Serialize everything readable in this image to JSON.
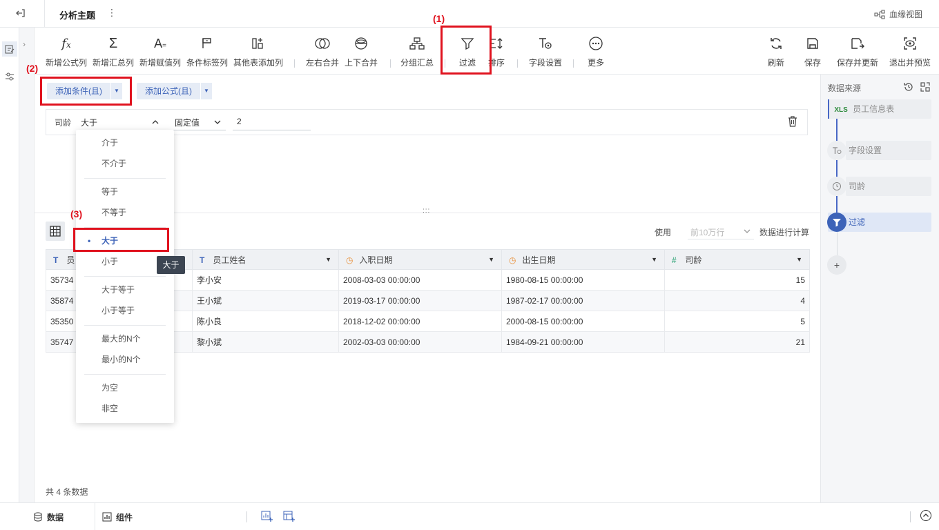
{
  "topbar": {
    "title": "分析主题",
    "lineage_label": "血缘视图"
  },
  "toolbar": {
    "items": [
      {
        "label": "新增公式列",
        "icon": "fx-icon"
      },
      {
        "label": "新增汇总列",
        "icon": "sigma-icon"
      },
      {
        "label": "新增赋值列",
        "icon": "assign-icon"
      },
      {
        "label": "条件标签列",
        "icon": "flag-icon"
      },
      {
        "label": "其他表添加列",
        "icon": "add-column-icon"
      },
      {
        "label": "左右合并",
        "icon": "merge-lr-icon"
      },
      {
        "label": "上下合并",
        "icon": "merge-ud-icon"
      },
      {
        "label": "分组汇总",
        "icon": "group-icon"
      },
      {
        "label": "过滤",
        "icon": "filter-icon"
      },
      {
        "label": "排序",
        "icon": "sort-icon"
      },
      {
        "label": "字段设置",
        "icon": "field-settings-icon"
      },
      {
        "label": "更多",
        "icon": "more-icon"
      }
    ],
    "right_items": [
      {
        "label": "刷新",
        "icon": "refresh-icon"
      },
      {
        "label": "保存",
        "icon": "save-icon"
      },
      {
        "label": "保存并更新",
        "icon": "save-update-icon"
      },
      {
        "label": "退出并预览",
        "icon": "exit-preview-icon"
      }
    ]
  },
  "filter": {
    "add_condition": "添加条件(且)",
    "add_formula": "添加公式(且)",
    "field": "司龄",
    "operator": "大于",
    "value_type": "固定值",
    "value": "2"
  },
  "dropdown": {
    "groups": [
      [
        "介于",
        "不介于"
      ],
      [
        "等于",
        "不等于"
      ],
      [
        "大于",
        "小于"
      ],
      [
        "大于等于",
        "小于等于"
      ],
      [
        "最大的N个",
        "最小的N个"
      ],
      [
        "为空",
        "非空"
      ]
    ],
    "selected": "大于"
  },
  "tooltip": "大于",
  "data": {
    "use_label": "使用",
    "rows_placeholder": "前10万行",
    "calc_label": "数据进行计算",
    "columns": [
      {
        "name": "员",
        "type": "text"
      },
      {
        "name": "员工姓名",
        "type": "text"
      },
      {
        "name": "入职日期",
        "type": "date"
      },
      {
        "name": "出生日期",
        "type": "date"
      },
      {
        "name": "司龄",
        "type": "number"
      }
    ],
    "rows": [
      [
        "35734",
        "李小安",
        "2008-03-03 00:00:00",
        "1980-08-15 00:00:00",
        "15"
      ],
      [
        "35874",
        "王小斌",
        "2019-03-17 00:00:00",
        "1987-02-17 00:00:00",
        "4"
      ],
      [
        "35350",
        "陈小良",
        "2018-12-02 00:00:00",
        "2000-08-15 00:00:00",
        "5"
      ],
      [
        "35747",
        "黎小斌",
        "2002-03-03 00:00:00",
        "1984-09-21 00:00:00",
        "21"
      ]
    ],
    "total": "共 4 条数据"
  },
  "right_panel": {
    "title": "数据来源",
    "steps": [
      "员工信息表",
      "字段设置",
      "司龄",
      "过滤"
    ],
    "source_badge": "XLS"
  },
  "bottom": {
    "tabs": [
      "数据",
      "组件"
    ]
  },
  "annotations": [
    "(1)",
    "(2)",
    "(3)"
  ],
  "colors": {
    "accent": "#3d63b8",
    "annotation": "#e0121e"
  }
}
